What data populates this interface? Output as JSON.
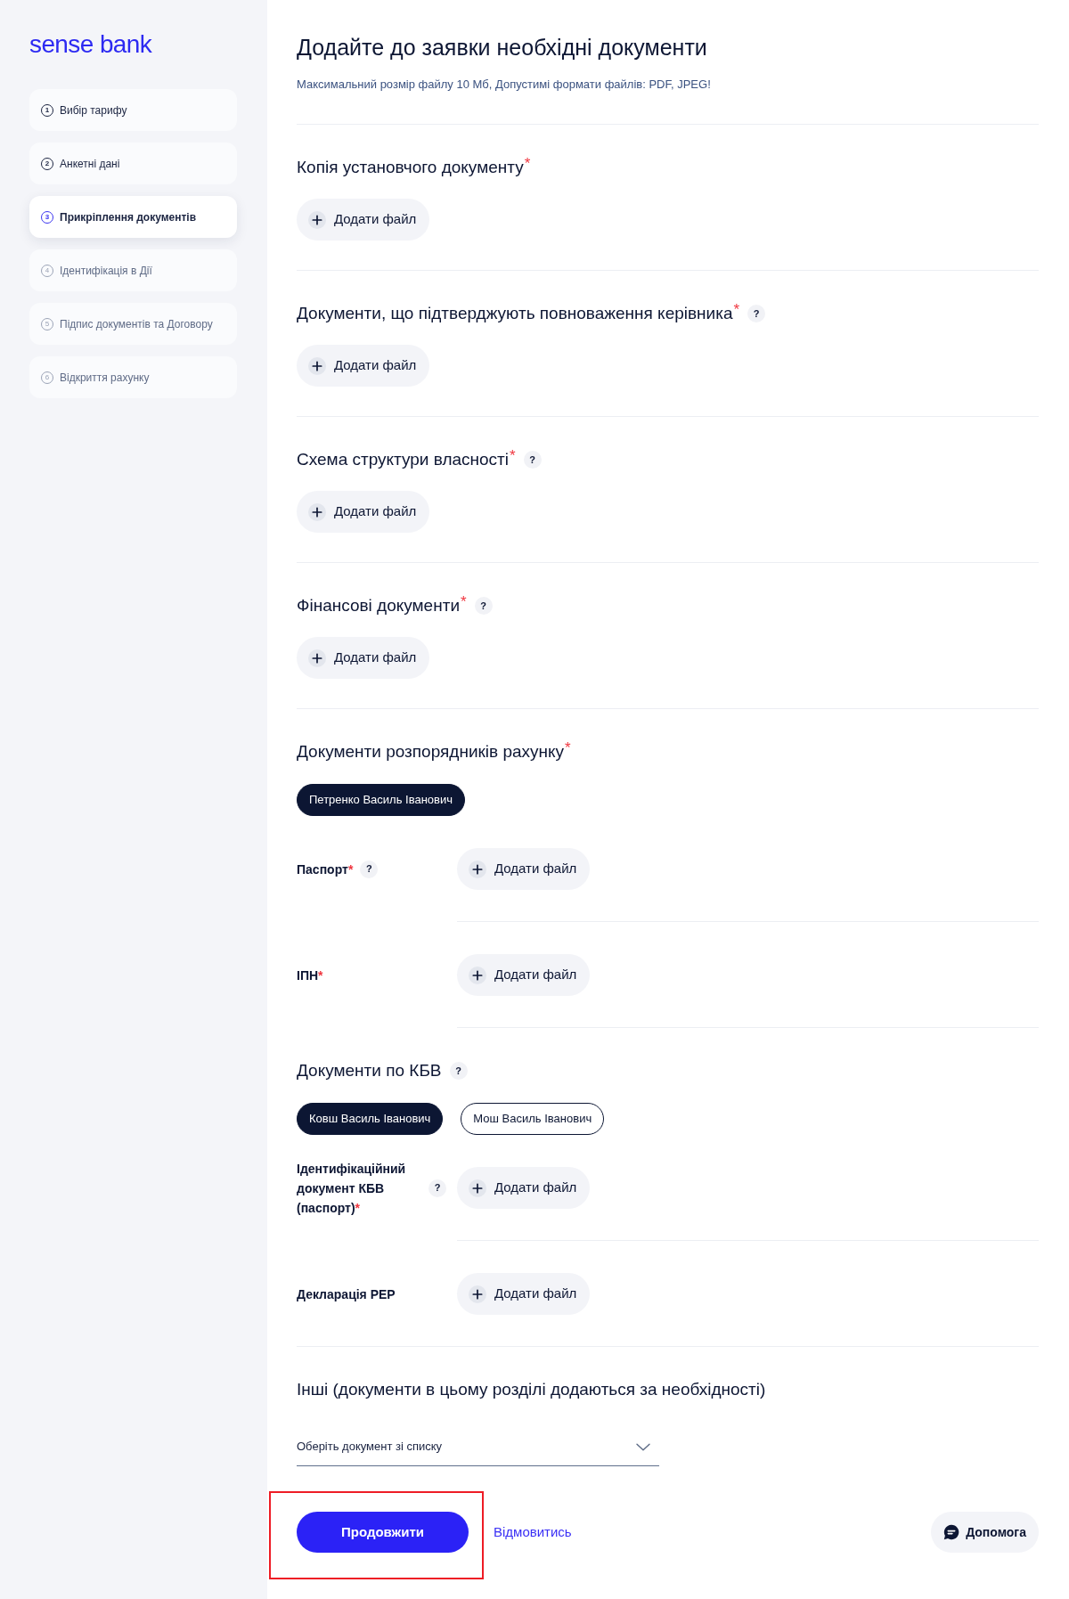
{
  "logo": {
    "text": "sense bank"
  },
  "steps": [
    {
      "number": "1",
      "label": "Вибір тарифу",
      "disabled": false,
      "selected": false
    },
    {
      "number": "2",
      "label": "Анкетні дані",
      "disabled": false,
      "selected": false
    },
    {
      "number": "3",
      "label": "Прикріплення документів",
      "disabled": false,
      "selected": true
    },
    {
      "number": "4",
      "label": "Ідентифікація в Дії",
      "disabled": true,
      "selected": false
    },
    {
      "number": "5",
      "label": "Підпис документів та Договору",
      "disabled": true,
      "selected": false
    },
    {
      "number": "6",
      "label": "Відкриття рахунку",
      "disabled": true,
      "selected": false
    }
  ],
  "header": {
    "title": "Додайте до заявки необхідні документи",
    "note": "Максимальний розмір файлу 10 Мб, Допустимі формати файлів: PDF, JPEG!"
  },
  "sections": [
    {
      "kind": "upload",
      "title": "Копія установчого документу",
      "required_mark": "*",
      "button": "Додати файл"
    },
    {
      "kind": "upload",
      "title": "Документи, що підтверджують повноваження керівника",
      "required_mark": "*",
      "help": "?",
      "button": "Додати файл"
    },
    {
      "kind": "upload",
      "title": "Схема структури власності",
      "required_mark": "*",
      "help": "?",
      "button": "Додати файл"
    },
    {
      "kind": "upload",
      "title": "Фінансові документи",
      "required_mark": "*",
      "help": "?",
      "button": "Додати файл"
    },
    {
      "kind": "persons",
      "title": "Документи розпорядників рахунку",
      "required_mark": "*",
      "people": [
        {
          "name": "Петренко Василь Іванович",
          "selected": true
        }
      ],
      "documents": [
        {
          "label": "Паспорт",
          "required_mark": "*",
          "help": "?",
          "button": "Додати файл"
        },
        {
          "label": "ІПН",
          "required_mark": "*",
          "button": "Додати файл"
        }
      ]
    },
    {
      "kind": "persons",
      "title": "Документи по КБВ",
      "help": "?",
      "people": [
        {
          "name": "Ковш Василь Іванович",
          "selected": true
        },
        {
          "name": "Мош Василь Іванович",
          "selected": false
        }
      ],
      "documents": [
        {
          "label": "Ідентифікаційний документ КБВ (паспорт)",
          "required_mark": "*",
          "help": "?",
          "button": "Додати файл"
        },
        {
          "label": "Декларація PEP",
          "button": "Додати файл"
        }
      ]
    },
    {
      "kind": "select",
      "title": "Інші (документи в цьому розділі додаються за необхідності)",
      "placeholder": "Оберіть документ зі списку"
    }
  ],
  "actions": {
    "continue": {
      "label": "Продовжити",
      "highlighted": true
    },
    "cancel": "Відмовитись",
    "help": "Допомога"
  }
}
